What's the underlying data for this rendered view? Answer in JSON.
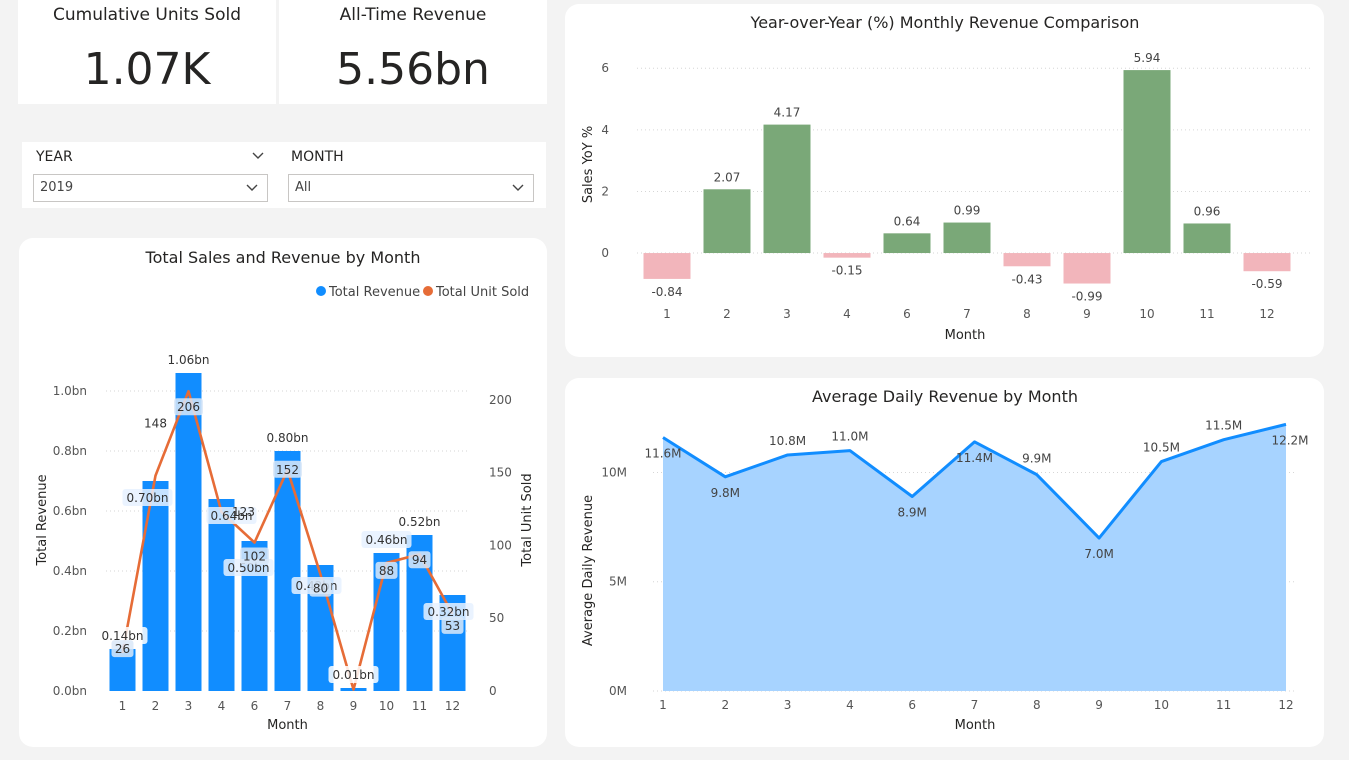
{
  "kpis": {
    "units": {
      "title": "Cumulative Units Sold",
      "value": "1.07K"
    },
    "revenue": {
      "title": "All-Time Revenue",
      "value": "5.56bn"
    }
  },
  "slicers": {
    "year": {
      "label": "YEAR",
      "value": "2019"
    },
    "month": {
      "label": "MONTH",
      "value": "All"
    }
  },
  "colors": {
    "revenue_bar": "#118dff",
    "units_line": "#e66c37",
    "yoy_positive": "#7aa878",
    "yoy_negative": "#f2b5bb",
    "area_fill": "#a7d3ff",
    "area_line": "#118dff"
  },
  "icons": {
    "chevron": "chevron-down-icon"
  },
  "chart_data": [
    {
      "id": "sales-revenue",
      "type": "bar",
      "title": "Total Sales and Revenue by Month",
      "xlabel": "Month",
      "ylabel": "Total Revenue",
      "y2label": "Total Unit Sold",
      "categories": [
        "1",
        "2",
        "3",
        "4",
        "6",
        "7",
        "8",
        "9",
        "10",
        "11",
        "12"
      ],
      "series": [
        {
          "name": "Total Revenue",
          "type": "bar",
          "values": [
            0.14,
            0.7,
            1.06,
            0.64,
            0.5,
            0.8,
            0.42,
            0.01,
            0.46,
            0.52,
            0.32
          ],
          "labels": [
            "0.14bn",
            "0.70bn",
            "1.06bn",
            "0.64bn",
            "0.50bn",
            "0.80bn",
            "0.42bn",
            "0.01bn",
            "0.46bn",
            "0.52bn",
            "0.32bn"
          ]
        },
        {
          "name": "Total Unit Sold",
          "type": "line",
          "values": [
            26,
            148,
            206,
            123,
            102,
            152,
            80,
            1,
            88,
            94,
            53
          ],
          "labels": [
            "26",
            "148",
            "206",
            "123",
            "102",
            "152",
            "80",
            "",
            "88",
            "94",
            "53"
          ]
        }
      ],
      "yticks": [
        "0.0bn",
        "0.2bn",
        "0.4bn",
        "0.6bn",
        "0.8bn",
        "1.0bn"
      ],
      "ylim": [
        0,
        1.14
      ],
      "y2ticks": [
        "0",
        "50",
        "100",
        "150",
        "200"
      ],
      "y2lim": [
        0,
        235
      ],
      "legend": "top-right",
      "grid": true
    },
    {
      "id": "yoy",
      "type": "bar",
      "title": "Year-over-Year (%) Monthly Revenue Comparison",
      "xlabel": "Month",
      "ylabel": "Sales YoY %",
      "categories": [
        "1",
        "2",
        "3",
        "4",
        "6",
        "7",
        "8",
        "9",
        "10",
        "11",
        "12"
      ],
      "values": [
        -0.84,
        2.07,
        4.17,
        -0.15,
        0.64,
        0.99,
        -0.43,
        -0.99,
        5.94,
        0.96,
        -0.59
      ],
      "labels": [
        "-0.84",
        "2.07",
        "4.17",
        "-0.15",
        "0.64",
        "0.99",
        "-0.43",
        "-0.99",
        "5.94",
        "0.96",
        "-0.59"
      ],
      "yticks": [
        "0",
        "2",
        "4",
        "6"
      ],
      "ylim": [
        -1.2,
        6.3
      ],
      "grid": true
    },
    {
      "id": "avg-daily",
      "type": "area",
      "title": "Average Daily Revenue by Month",
      "xlabel": "Month",
      "ylabel": "Average Daily Revenue",
      "categories": [
        "1",
        "2",
        "3",
        "4",
        "6",
        "7",
        "8",
        "9",
        "10",
        "11",
        "12"
      ],
      "values": [
        11.6,
        9.8,
        10.8,
        11.0,
        8.9,
        11.4,
        9.9,
        7.0,
        10.5,
        11.5,
        12.2
      ],
      "labels": [
        "11.6M",
        "9.8M",
        "10.8M",
        "11.0M",
        "8.9M",
        "11.4M",
        "9.9M",
        "7.0M",
        "10.5M",
        "11.5M",
        "12.2M"
      ],
      "yticks": [
        "0M",
        "5M",
        "10M"
      ],
      "ylim": [
        0,
        12.4
      ],
      "grid": true
    }
  ]
}
